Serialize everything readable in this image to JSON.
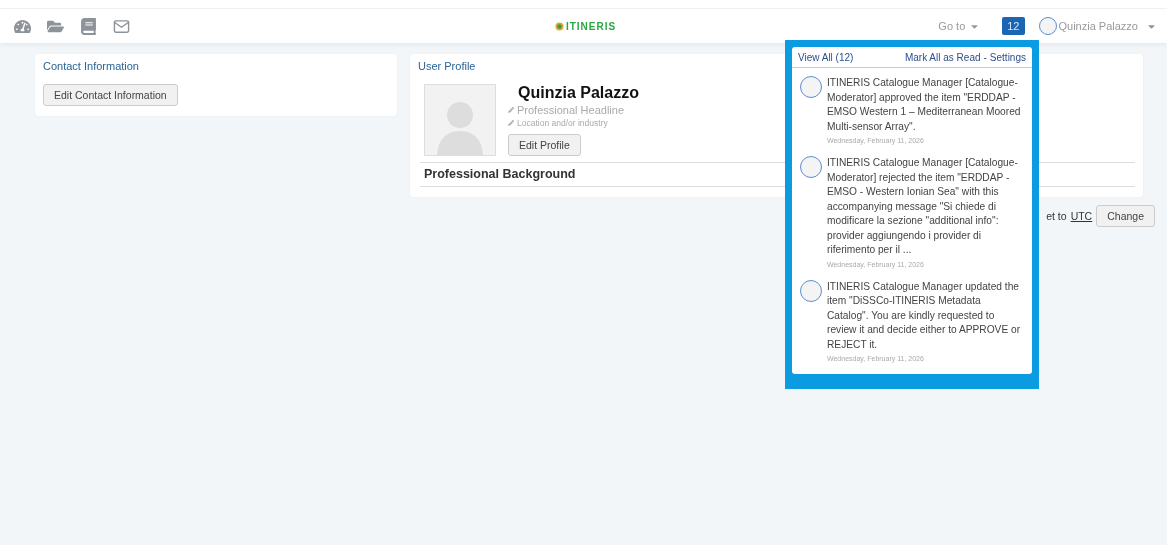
{
  "header": {
    "logo": "ITINERIS",
    "goto": "Go to",
    "badge": "12",
    "user": "Quinzia Palazzo"
  },
  "contact": {
    "title": "Contact Information",
    "button": "Edit Contact Information"
  },
  "profile": {
    "title": "User Profile",
    "name": "Quinzia Palazzo",
    "headline": "Professional Headline",
    "location": "Location and/or industry",
    "button": "Edit Profile",
    "section": "Professional Background"
  },
  "timezone": {
    "text": "et to",
    "link": "UTC",
    "button": "Change"
  },
  "notifications": {
    "view_all": "View All (12)",
    "mark_read": "Mark All as Read",
    "separator": "-",
    "settings": "Settings",
    "items": [
      {
        "text": "ITINERIS Catalogue Manager [Catalogue-Moderator] approved the item \"ERDDAP - EMSO Western 1 – Mediterranean Moored Multi-sensor Array\".",
        "date": "Wednesday, February 11, 2026"
      },
      {
        "text": "ITINERIS Catalogue Manager [Catalogue-Moderator] rejected the item \"ERDDAP - EMSO - Western Ionian Sea\" with this accompanying message \"Si chiede di modificare la sezione \"additional info\": provider aggiungendo i provider di riferimento per il ...",
        "date": "Wednesday, February 11, 2026"
      },
      {
        "text": "ITINERIS Catalogue Manager updated the item \"DiSSCo-ITINERIS Metadata Catalog\". You are kindly requested to review it and decide either to APPROVE or REJECT it.",
        "date": "Wednesday, February 11, 2026"
      }
    ]
  }
}
